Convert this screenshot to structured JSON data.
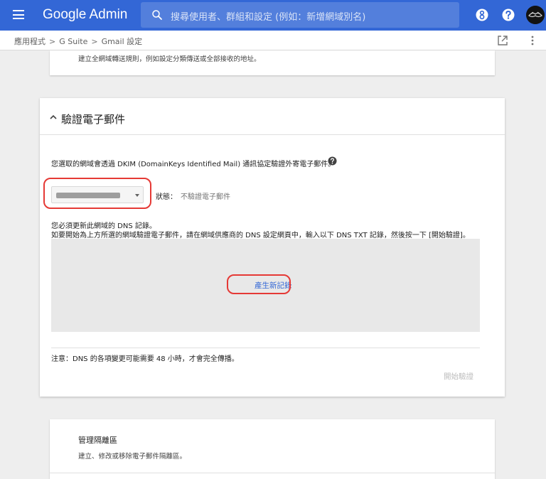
{
  "topbar": {
    "logo": "Google Admin",
    "search_placeholder": "搜尋使用者、群組和設定 (例如：新增網域別名)",
    "icons": [
      "menu-icon",
      "search-icon",
      "apps-icon",
      "help-icon",
      "avatar"
    ],
    "accent_color": "#3367d6"
  },
  "breadcrumb": {
    "items": [
      "應用程式",
      "G Suite",
      "Gmail 設定"
    ],
    "separator": ">"
  },
  "routing_card": {
    "description": "建立全網域轉送規則，例如設定分類傳送或全部接收的地址。"
  },
  "dkim_card": {
    "title": "驗證電子郵件",
    "description": "您選取的網域會透過 DKIM (DomainKeys Identified Mail) 通訊協定驗證外寄電子郵件。",
    "status_label": "狀態：",
    "status_value": "不驗證電子郵件",
    "dns_line1": "您必須更新此網域的 DNS 記錄。",
    "dns_line2": "如要開始為上方所選的網域驗證電子郵件，請在網域供應商的 DNS 設定網頁中，輸入以下 DNS TXT 記錄，然後按一下 [開始驗證]。",
    "generate_label": "產生新記錄",
    "note": "注意：DNS 的各項變更可能需要 48 小時，才會完全傳播。",
    "start_button": "開始驗證"
  },
  "quarantine_card": {
    "title": "管理隔離區",
    "description": "建立、修改或移除電子郵件隔離區。"
  }
}
